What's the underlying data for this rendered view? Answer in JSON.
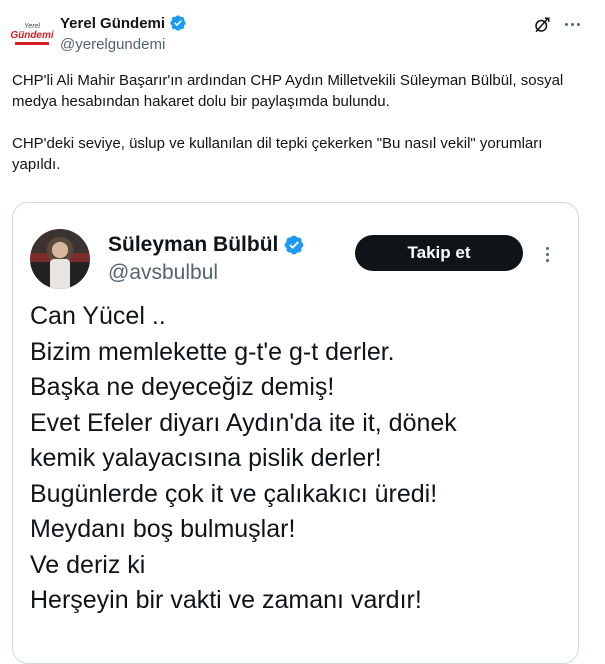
{
  "account": {
    "logo_line1": "Yerel",
    "logo_line2": "Gündemi",
    "name": "Yerel Gündemi",
    "handle": "@yerelgundemi"
  },
  "tweet": {
    "paragraph1": "CHP'li Ali Mahir Başarır'ın ardından CHP Aydın Milletvekili Süleyman Bülbül, sosyal medya hesabından hakaret dolu bir paylaşımda bulundu.",
    "paragraph2": "CHP'deki seviye, üslup ve kullanılan dil tepki çekerken \"Bu nasıl vekil\" yorumları yapıldı."
  },
  "embedded": {
    "name": "Süleyman Bülbül",
    "handle": "@avsbulbul",
    "follow_label": "Takip et",
    "lines": [
      "Can Yücel ..",
      "Bizim memlekette g-t'e g-t derler.",
      "Başka ne deyeceğiz demiş!",
      "Evet Efeler diyarı Aydın'da ite it, dönek",
      "kemik yalayacısına pislik derler!",
      "Bugünlerde çok it ve çalıkakıcı üredi!",
      "Meydanı boş bulmuşlar!",
      "Ve deriz ki",
      "Herşeyin bir vakti ve zamanı vardır!"
    ]
  },
  "colors": {
    "verified": "#1d9bf0",
    "text": "#0f1419",
    "secondary": "#536471",
    "border": "#cfd9de",
    "logo_red": "#d42020"
  },
  "icons": [
    "verified-badge-icon",
    "grok-icon",
    "more-icon"
  ]
}
